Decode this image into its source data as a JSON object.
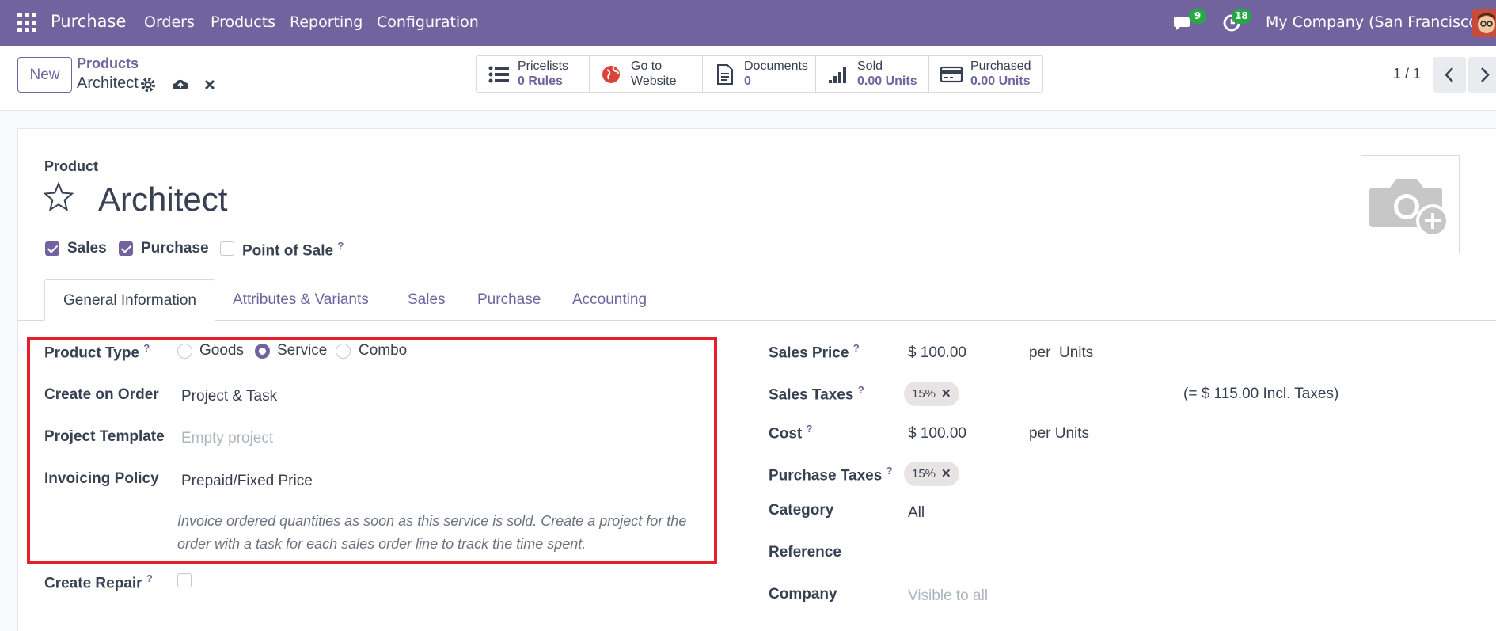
{
  "navbar": {
    "app_name": "Purchase",
    "menu": [
      "Orders",
      "Products",
      "Reporting",
      "Configuration"
    ],
    "messages_count": "9",
    "activities_count": "18",
    "company": "My Company (San Francisco)"
  },
  "control_panel": {
    "new_label": "New",
    "breadcrumb_parent": "Products",
    "breadcrumb_current": "Architect",
    "smart_buttons": [
      {
        "line1": "Pricelists",
        "line2": "0  Rules",
        "icon": "list-icon"
      },
      {
        "line1": "Go to",
        "line2": "Website",
        "icon": "globe-icon"
      },
      {
        "line1": "Documents",
        "line2": "0",
        "icon": "document-icon"
      },
      {
        "line1": "Sold",
        "line2": "0.00 Units",
        "icon": "bar-chart-icon"
      },
      {
        "line1": "Purchased",
        "line2": "0.00 Units",
        "icon": "credit-card-icon"
      }
    ],
    "pager": "1 / 1"
  },
  "form": {
    "product_label": "Product",
    "name": "Architect",
    "checkboxes": [
      {
        "label": "Sales",
        "checked": true
      },
      {
        "label": "Purchase",
        "checked": true
      },
      {
        "label": "Point of Sale",
        "checked": false
      }
    ],
    "tabs": [
      "General Information",
      "Attributes & Variants",
      "Sales",
      "Purchase",
      "Accounting"
    ],
    "left": {
      "product_type_label": "Product Type",
      "product_type_options": [
        "Goods",
        "Service",
        "Combo"
      ],
      "product_type_selected": "Service",
      "create_on_order_label": "Create on Order",
      "create_on_order_value": "Project & Task",
      "project_template_label": "Project Template",
      "project_template_placeholder": "Empty project",
      "invoicing_policy_label": "Invoicing Policy",
      "invoicing_policy_value": "Prepaid/Fixed Price",
      "invoicing_note": "Invoice ordered quantities as soon as this service is sold. Create a project for the order with a task for each sales order line to track the time spent.",
      "create_repair_label": "Create Repair"
    },
    "right": {
      "sales_price_label": "Sales Price",
      "sales_price_value": "$ 100.00",
      "sales_price_unit": "per  Units",
      "sales_taxes_label": "Sales Taxes",
      "sales_tax_tag": "15%",
      "sales_taxes_incl": "(= $ 115.00 Incl. Taxes)",
      "cost_label": "Cost",
      "cost_value": "$ 100.00",
      "cost_unit": "per Units",
      "purchase_taxes_label": "Purchase Taxes",
      "purchase_tax_tag": "15%",
      "category_label": "Category",
      "category_value": "All",
      "reference_label": "Reference",
      "company_label": "Company",
      "company_placeholder": "Visible to all"
    }
  },
  "colors": {
    "brand": "#71639e",
    "highlight_box": "#e41e2a",
    "badge": "#28a745"
  }
}
